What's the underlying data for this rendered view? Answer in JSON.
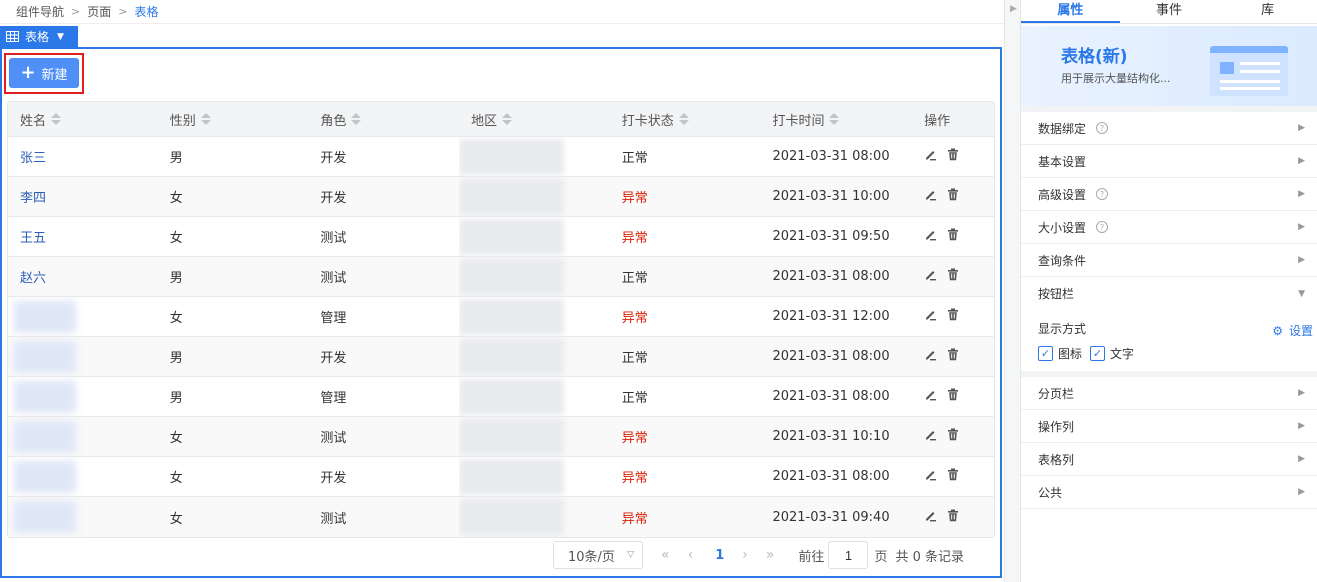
{
  "breadcrumb": {
    "items": [
      "组件导航",
      "页面"
    ],
    "current": "表格"
  },
  "component_tag": {
    "label": "表格"
  },
  "toolbar": {
    "new_label": "新建"
  },
  "table": {
    "columns": [
      "姓名",
      "性别",
      "角色",
      "地区",
      "打卡状态",
      "打卡时间",
      "操作"
    ],
    "rows": [
      {
        "name": "张三",
        "gender": "男",
        "role": "开发",
        "status": "正常",
        "time": "2021-03-31 08:00"
      },
      {
        "name": "李四",
        "gender": "女",
        "role": "开发",
        "status": "异常",
        "time": "2021-03-31 10:00"
      },
      {
        "name": "王五",
        "gender": "女",
        "role": "测试",
        "status": "异常",
        "time": "2021-03-31 09:50"
      },
      {
        "name": "赵六",
        "gender": "男",
        "role": "测试",
        "status": "正常",
        "time": "2021-03-31 08:00"
      },
      {
        "name": "",
        "gender": "女",
        "role": "管理",
        "status": "异常",
        "time": "2021-03-31 12:00"
      },
      {
        "name": "",
        "gender": "男",
        "role": "开发",
        "status": "正常",
        "time": "2021-03-31 08:00"
      },
      {
        "name": "",
        "gender": "男",
        "role": "管理",
        "status": "正常",
        "time": "2021-03-31 08:00"
      },
      {
        "name": "",
        "gender": "女",
        "role": "测试",
        "status": "异常",
        "time": "2021-03-31 10:10"
      },
      {
        "name": "",
        "gender": "女",
        "role": "开发",
        "status": "异常",
        "time": "2021-03-31 08:00"
      },
      {
        "name": "",
        "gender": "女",
        "role": "测试",
        "status": "异常",
        "time": "2021-03-31 09:40"
      }
    ]
  },
  "pagination": {
    "page_size": "10条/页",
    "current_page": "1",
    "goto_label": "前往",
    "goto_value": "1",
    "page_unit": "页",
    "total": "共 0 条记录"
  },
  "right_panel": {
    "tabs": [
      "属性",
      "事件",
      "库"
    ],
    "active_tab": "属性",
    "hero_title": "表格(新)",
    "hero_desc": "用于展示大量结构化...",
    "sections_before": [
      "数据绑定",
      "基本设置",
      "高级设置",
      "大小设置",
      "查询条件",
      "按钮栏"
    ],
    "sections_with_help": [
      "数据绑定",
      "高级设置",
      "大小设置"
    ],
    "button_bar": {
      "display_label": "显示方式",
      "settings_label": "设置",
      "options": [
        {
          "label": "图标",
          "checked": true
        },
        {
          "label": "文字",
          "checked": true
        }
      ]
    },
    "sections_after": [
      "分页栏",
      "操作列",
      "表格列",
      "公共"
    ]
  },
  "colors": {
    "accent": "#2b79e8",
    "abnormal": "#d81e06",
    "selection": "#e02020"
  }
}
